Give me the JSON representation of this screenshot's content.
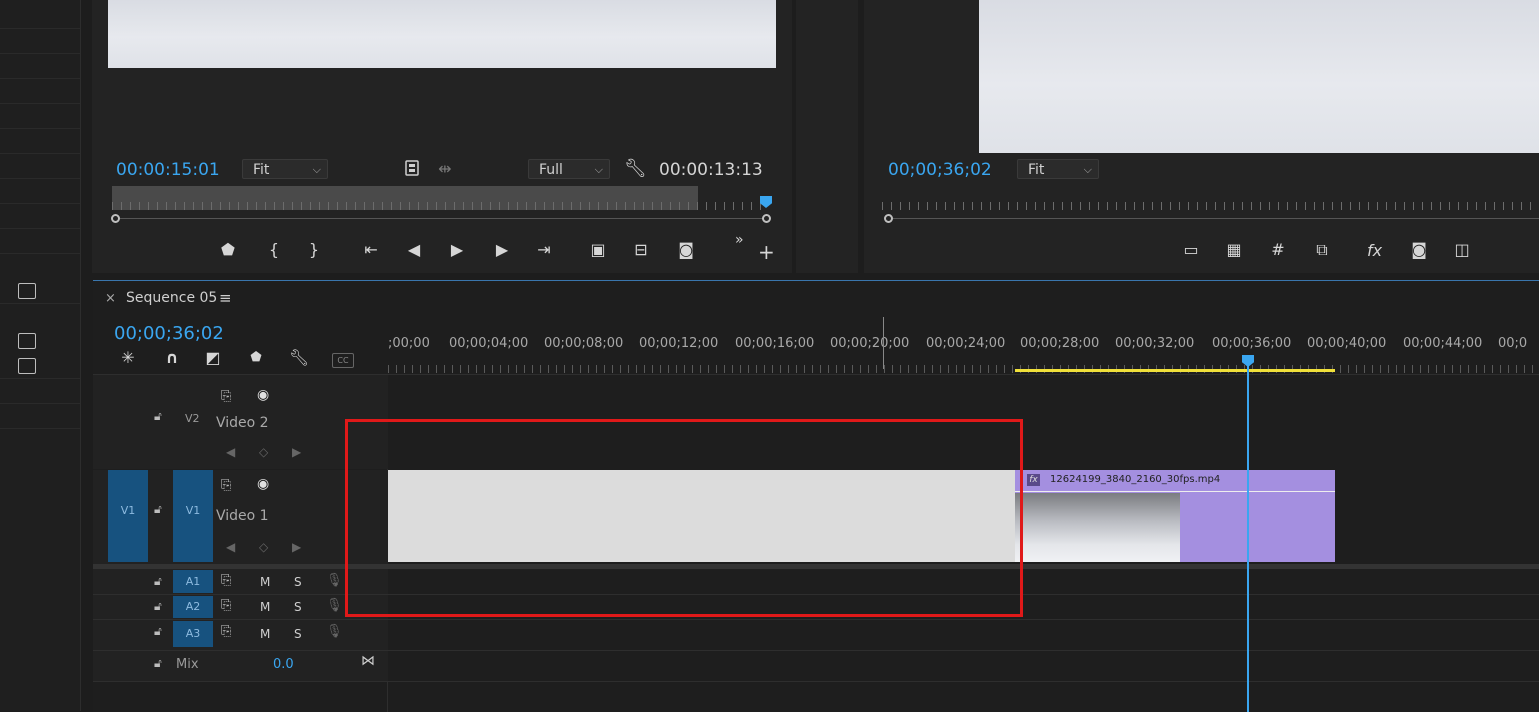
{
  "source_monitor": {
    "timecode_current": "00:00:15:01",
    "zoom_dropdown": "Fit",
    "resolution_dropdown": "Full",
    "timecode_duration": "00:00:13:13",
    "overflow_label": "»",
    "add_label": "+"
  },
  "program_monitor": {
    "timecode_current": "00;00;36;02",
    "zoom_dropdown": "Fit",
    "fx_label": "fx"
  },
  "timeline": {
    "close_label": "×",
    "sequence_name": "Sequence 05",
    "menu_icon": "≡",
    "timecode": "00;00;36;02",
    "cc_label": "CC",
    "ruler_labels": [
      ";00;00",
      "00;00;04;00",
      "00;00;08;00",
      "00;00;12;00",
      "00;00;16;00",
      "00;00;20;00",
      "00;00;24;00",
      "00;00;28;00",
      "00;00;32;00",
      "00;00;36;00",
      "00;00;40;00",
      "00;00;44;00",
      "00;0"
    ],
    "tracks": {
      "v2": {
        "id": "V2",
        "name": "Video 2"
      },
      "v1": {
        "source": "V1",
        "id": "V1",
        "name": "Video 1"
      },
      "audio": [
        {
          "id": "A1",
          "m": "M",
          "s": "S"
        },
        {
          "id": "A2",
          "m": "M",
          "s": "S"
        },
        {
          "id": "A3",
          "m": "M",
          "s": "S"
        }
      ],
      "mix": {
        "label": "Mix",
        "value": "0.0"
      }
    },
    "clip": {
      "fx_badge": "fx",
      "name": "12624199_3840_2160_30fps.mp4"
    },
    "colors": {
      "accent": "#3aa6f0",
      "clip": "#a48fe0",
      "highlight_box": "#e01919",
      "work_area": "#f0e03a"
    }
  }
}
